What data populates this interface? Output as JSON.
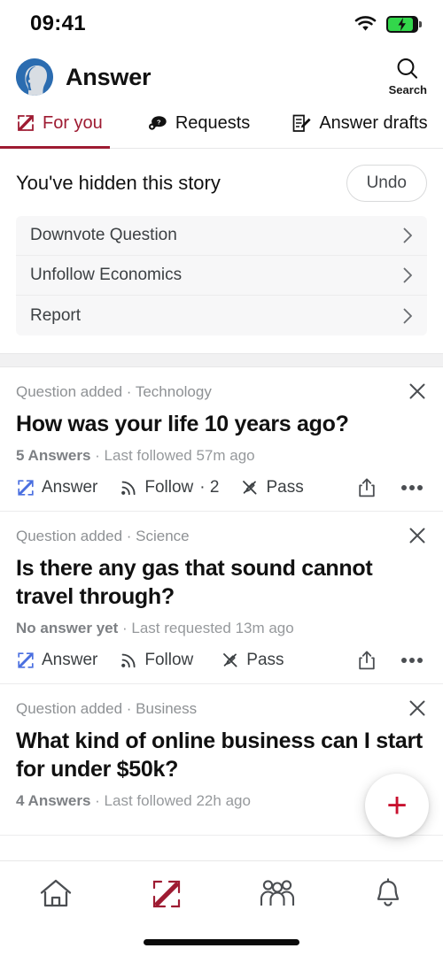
{
  "status_bar": {
    "time": "09:41",
    "wifi_icon": "wifi-icon",
    "battery_icon": "battery-charging-icon"
  },
  "header": {
    "logo_icon": "answer-avatar-logo",
    "title": "Answer",
    "search_icon": "search-icon",
    "search_label": "Search"
  },
  "tabs": [
    {
      "label": "For you",
      "icon": "pencil-square-icon",
      "active": true
    },
    {
      "label": "Requests",
      "icon": "question-bubble-icon",
      "active": false
    },
    {
      "label": "Answer drafts",
      "icon": "draft-pencil-icon",
      "active": false
    }
  ],
  "hidden_story": {
    "title": "You've hidden this story",
    "undo_label": "Undo",
    "options": [
      {
        "label": "Downvote Question",
        "chevron": "chevron-right-icon"
      },
      {
        "label": "Unfollow Economics",
        "chevron": "chevron-right-icon"
      },
      {
        "label": "Report",
        "chevron": "chevron-right-icon"
      }
    ]
  },
  "feed": [
    {
      "meta": "Question added · Technology",
      "close_icon": "close-icon",
      "title": "How was your life 10 years ago?",
      "answers": "5 Answers",
      "sub_rest": " · Last followed 57m ago",
      "answer_label": "Answer",
      "follow_label": "Follow",
      "follow_count": " · 2",
      "pass_label": "Pass",
      "share_icon": "share-icon",
      "more_icon": "more-horizontal-icon"
    },
    {
      "meta": "Question added · Science",
      "close_icon": "close-icon",
      "title": "Is there any gas that sound cannot travel through?",
      "answers": "No answer yet",
      "sub_rest": " · Last requested 13m ago",
      "answer_label": "Answer",
      "follow_label": "Follow",
      "follow_count": "",
      "pass_label": "Pass",
      "share_icon": "share-icon",
      "more_icon": "more-horizontal-icon"
    },
    {
      "meta": "Question added · Business",
      "close_icon": "close-icon",
      "title": "What kind of online business can I start for under $50k?",
      "answers": "4 Answers",
      "sub_rest": " · Last followed 22h ago"
    }
  ],
  "fab": {
    "icon": "plus-icon",
    "label": "+"
  },
  "bottom_nav": [
    {
      "name": "home",
      "icon": "home-icon",
      "active": false
    },
    {
      "name": "answer",
      "icon": "pencil-square-icon",
      "active": true
    },
    {
      "name": "spaces",
      "icon": "people-group-icon",
      "active": false
    },
    {
      "name": "notifications",
      "icon": "bell-icon",
      "active": false
    }
  ],
  "colors": {
    "accent_red": "#9e1b32",
    "fab_red": "#c8102e",
    "answer_blue": "#4a6fe0",
    "logo_blue": "#2b6cb0",
    "battery_green": "#32d74b"
  }
}
